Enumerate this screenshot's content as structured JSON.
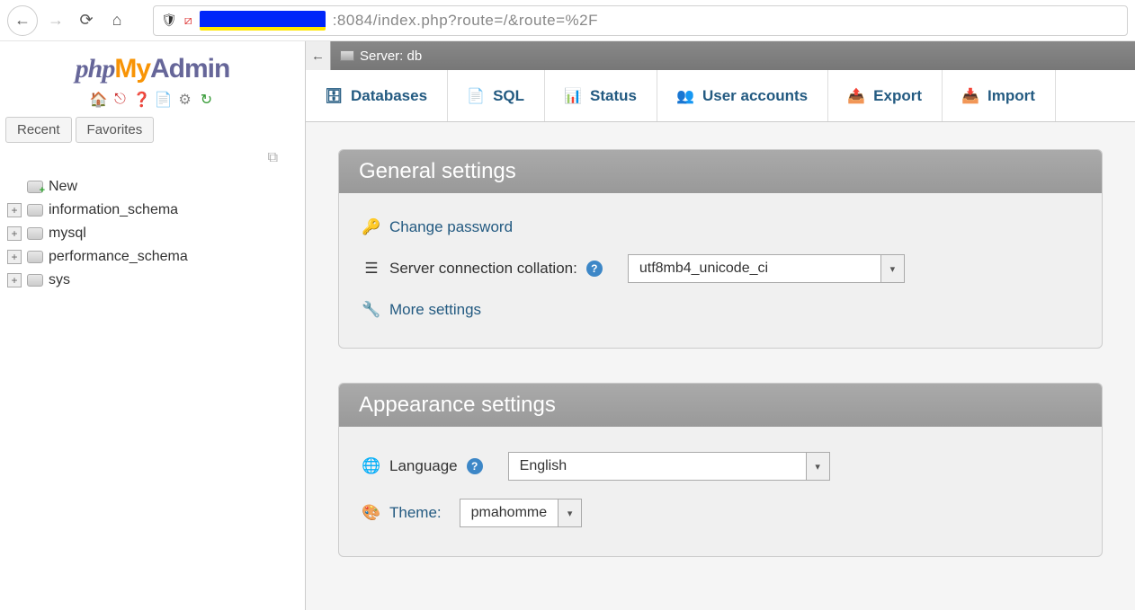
{
  "browser": {
    "url_tail": ":8084/index.php?route=/&route=%2F"
  },
  "logo": {
    "php": "php",
    "my": "My",
    "admin": "Admin"
  },
  "sidebar": {
    "tabs": {
      "recent": "Recent",
      "favorites": "Favorites"
    },
    "items": [
      {
        "label": "New",
        "new": true
      },
      {
        "label": "information_schema"
      },
      {
        "label": "mysql"
      },
      {
        "label": "performance_schema"
      },
      {
        "label": "sys"
      }
    ]
  },
  "crumb": {
    "server_label": "Server: db"
  },
  "top_tabs": [
    {
      "label": "Databases"
    },
    {
      "label": "SQL"
    },
    {
      "label": "Status"
    },
    {
      "label": "User accounts"
    },
    {
      "label": "Export"
    },
    {
      "label": "Import"
    }
  ],
  "panels": {
    "general": {
      "title": "General settings",
      "change_password": "Change password",
      "collation_label": "Server connection collation:",
      "collation_value": "utf8mb4_unicode_ci",
      "more": "More settings"
    },
    "appearance": {
      "title": "Appearance settings",
      "language_label": "Language",
      "language_value": "English",
      "theme_label": "Theme:",
      "theme_value": "pmahomme"
    }
  }
}
